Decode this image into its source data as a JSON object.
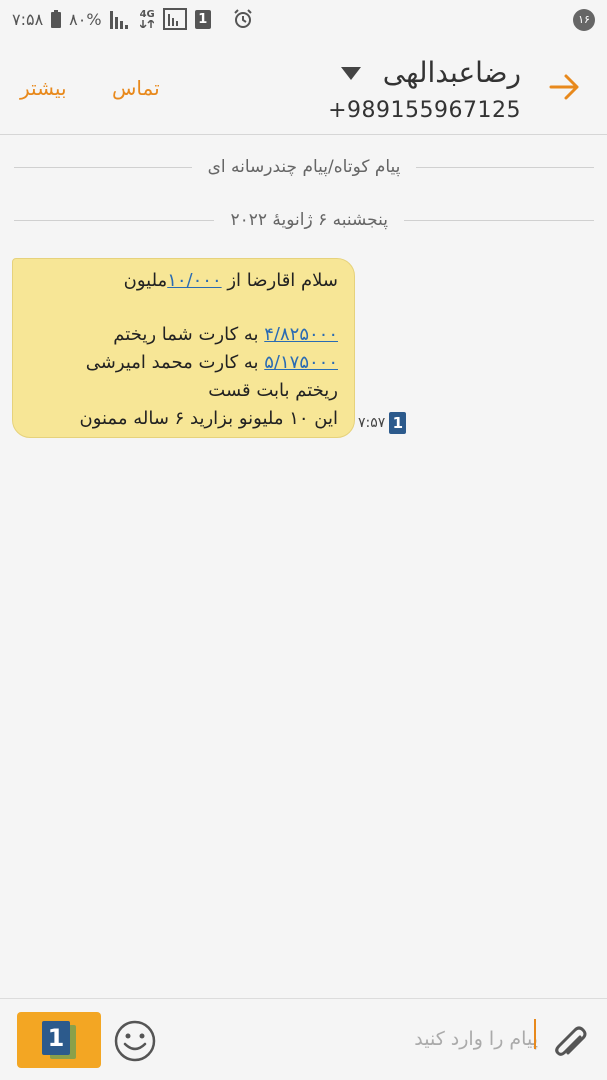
{
  "status_bar": {
    "time": "۷:۵۸",
    "battery_percent": "۸۰%",
    "network": "4G",
    "sim_slot": "1",
    "notification_count": "۱۶"
  },
  "header": {
    "contact_name": "رضاعبدالهی",
    "phone_number": "+989155967125",
    "call_label": "تماس",
    "more_label": "بیشتر",
    "accent_color": "#e8891c"
  },
  "thread": {
    "message_type_label": "پیام کوتاه/پیام چندرسانه ای",
    "date_label": "پنجشنبه ۶ ژانویهٔ ۲۰۲۲",
    "messages": [
      {
        "line1_a": "سلام اقارضا   از ",
        "line1_link": "۱۰/۰۰۰",
        "line1_b": "ملیون",
        "line2_link": "۴/۸۲۵۰۰۰",
        "line2_text": " به کارت شما ریختم",
        "line3_link": "۵/۱۷۵۰۰۰",
        "line3_text": " به کارت محمد امیرشی",
        "line4": "ریختم بابت قست",
        "line5": "این ۱۰ ملیونو بزارید ۶ ساله ممنون",
        "time": "۷:۵۷",
        "sim": "1",
        "bubble_color": "#f7e696"
      }
    ]
  },
  "composer": {
    "placeholder": "پیام را وارد کنید",
    "sim": "1",
    "send_color": "#f3a623"
  }
}
